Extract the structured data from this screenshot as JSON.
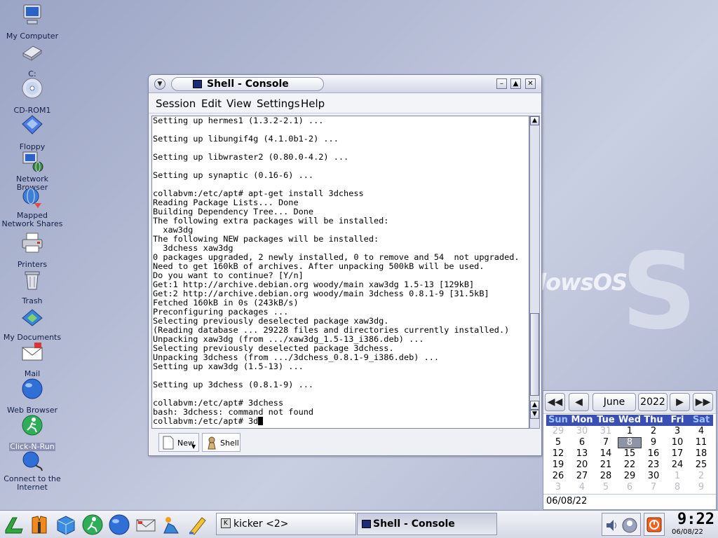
{
  "desktop": {
    "icons": [
      {
        "label": "My Computer"
      },
      {
        "label": "C:"
      },
      {
        "label": "CD-ROM1"
      },
      {
        "label": "Floppy"
      },
      {
        "label": "Network Browser"
      },
      {
        "label": "Mapped Network Shares"
      },
      {
        "label": "Printers"
      },
      {
        "label": "Trash"
      },
      {
        "label": "My Documents"
      },
      {
        "label": "Mail"
      },
      {
        "label": "Web Browser"
      },
      {
        "label": "Click-N-Run"
      },
      {
        "label": "Connect to the Internet"
      }
    ],
    "wallpaper_text": "dowsOS"
  },
  "window": {
    "title": "Shell - Console",
    "menu": [
      "Session",
      "Edit",
      "View",
      "Settings",
      "Help"
    ],
    "terminal_lines": [
      "Setting up hermes1 (1.3.2-2.1) ...",
      "",
      "Setting up libungif4g (4.1.0b1-2) ...",
      "",
      "Setting up libwraster2 (0.80.0-4.2) ...",
      "",
      "Setting up synaptic (0.16-6) ...",
      "",
      "collabvm:/etc/apt# apt-get install 3dchess",
      "Reading Package Lists... Done",
      "Building Dependency Tree... Done",
      "The following extra packages will be installed:",
      "  xaw3dg",
      "The following NEW packages will be installed:",
      "  3dchess xaw3dg",
      "0 packages upgraded, 2 newly installed, 0 to remove and 54  not upgraded.",
      "Need to get 160kB of archives. After unpacking 500kB will be used.",
      "Do you want to continue? [Y/n]",
      "Get:1 http://archive.debian.org woody/main xaw3dg 1.5-13 [129kB]",
      "Get:2 http://archive.debian.org woody/main 3dchess 0.8.1-9 [31.5kB]",
      "Fetched 160kB in 0s (243kB/s)",
      "Preconfiguring packages ...",
      "Selecting previously deselected package xaw3dg.",
      "(Reading database ... 29228 files and directories currently installed.)",
      "Unpacking xaw3dg (from .../xaw3dg_1.5-13_i386.deb) ...",
      "Selecting previously deselected package 3dchess.",
      "Unpacking 3dchess (from .../3dchess_0.8.1-9_i386.deb) ...",
      "Setting up xaw3dg (1.5-13) ...",
      "",
      "Setting up 3dchess (0.8.1-9) ...",
      "",
      "collabvm:/etc/apt# 3dchess",
      "bash: 3dchess: command not found"
    ],
    "prompt_line": "collabvm:/etc/apt# 3d",
    "tabs": {
      "new_label": "New",
      "shell_label": "Shell"
    }
  },
  "calendar": {
    "month": "June",
    "year": "2022",
    "weekdays": [
      "Sun",
      "Mon",
      "Tue",
      "Wed",
      "Thu",
      "Fri",
      "Sat"
    ],
    "weeks": [
      [
        "29",
        "30",
        "31",
        "1",
        "2",
        "3",
        "4"
      ],
      [
        "5",
        "6",
        "7",
        "8",
        "9",
        "10",
        "11"
      ],
      [
        "12",
        "13",
        "14",
        "15",
        "16",
        "17",
        "18"
      ],
      [
        "19",
        "20",
        "21",
        "22",
        "23",
        "24",
        "25"
      ],
      [
        "26",
        "27",
        "28",
        "29",
        "30",
        "1",
        "2"
      ],
      [
        "3",
        "4",
        "5",
        "6",
        "7",
        "8",
        "9"
      ]
    ],
    "selected_day": "8",
    "date_field": "06/08/22"
  },
  "taskbar": {
    "tasks": [
      {
        "label": "kicker <2>"
      },
      {
        "label": "Shell - Console"
      }
    ],
    "clock_time": "9:22",
    "clock_date": "06/08/22"
  },
  "colors": {
    "weekday_header": "#3a4fb4",
    "window_border": "#7e86a8"
  }
}
